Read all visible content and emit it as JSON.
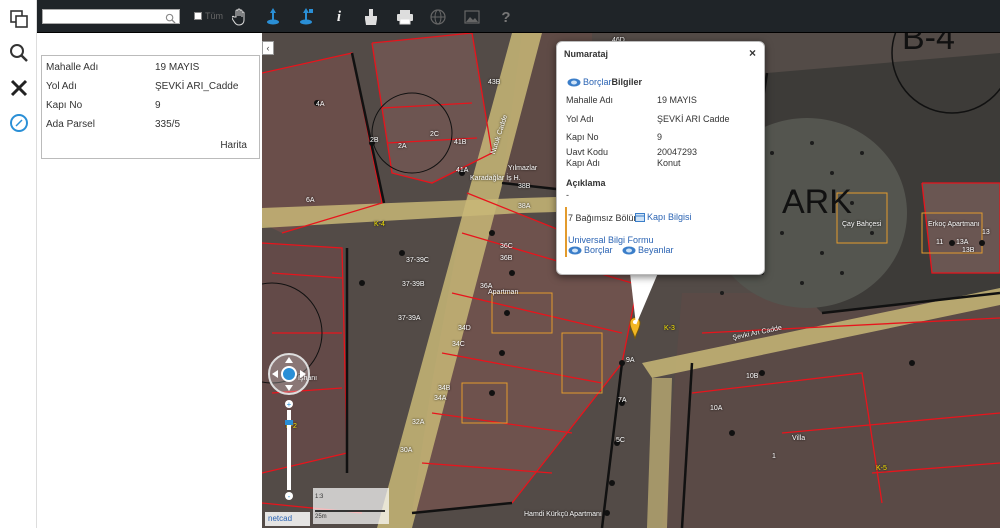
{
  "toolbar": {
    "search_placeholder": "",
    "checkbox_label": "Tüm",
    "info_glyph": "i",
    "help_glyph": "?"
  },
  "left_tools": [
    "layers-icon",
    "search-icon",
    "tools-icon",
    "compass-icon"
  ],
  "info_panel": {
    "rows": [
      {
        "label": "Mahalle Adı",
        "value": "19 MAYIS"
      },
      {
        "label": "Yol Adı",
        "value": "ŞEVKİ ARI_Cadde"
      },
      {
        "label": "Kapı No",
        "value": "9"
      },
      {
        "label": "Ada Parsel",
        "value": "335/5"
      }
    ],
    "harita_label": "Harita",
    "collapse_glyph": "‹"
  },
  "popup": {
    "title": "Numarataj",
    "close": "×",
    "borclar_a": "Borçlar",
    "borclar_b": "Bilgiler",
    "rows": [
      {
        "label": "Mahalle Adı",
        "value": "19 MAYIS"
      },
      {
        "label": "Yol Adı",
        "value": "ŞEVKİ ARI Cadde"
      },
      {
        "label": "Kapı No",
        "value": "9"
      },
      {
        "label": "Uavt Kodu",
        "value": "20047293"
      },
      {
        "label": "Kapı Adı",
        "value": "Konut"
      }
    ],
    "aciklama_label": "Açıklama",
    "aciklama_value": "-",
    "bagimsiz": "7 Bağımsız Bölüm",
    "kapi_bilgisi": "Kapı Bilgisi",
    "universal": "Universal Bilgi Formu",
    "borclar": "Borçlar",
    "beyanlar": "Beyanlar"
  },
  "map_labels": [
    "46D",
    "46C",
    "3A",
    "46B",
    "43B",
    "4A",
    "2B",
    "2A",
    "2C",
    "41B",
    "41A",
    "6A",
    "38B",
    "38A",
    "36C",
    "36B",
    "36A",
    "37-39C",
    "37-39B",
    "37-39A",
    "34D",
    "34C",
    "34B",
    "34A",
    "32A",
    "30A",
    "9A",
    "5C",
    "7A",
    "1",
    "10B",
    "10A",
    "13",
    "13A",
    "13B",
    "11",
    "Çay Bahçesi",
    "Erkoç Apartmanı",
    "Apartman",
    "İşhanı",
    "Villa",
    "Hamdi Kürkçü Apartmanı",
    "Şevki Arı Cadde",
    "Nutuk Cadde",
    "Yılmazlar",
    "Karadağlar İş H.",
    "B-4",
    "K-4",
    "K-3",
    "K-2",
    "K-5",
    "ARK"
  ],
  "scale_label": "1:3",
  "scale_unit": "25m",
  "brand": "netcad",
  "colors": {
    "accent": "#2a63b3",
    "toolbar": "#1f2428",
    "parcel": "#e8141c",
    "road": "#c8b777"
  }
}
